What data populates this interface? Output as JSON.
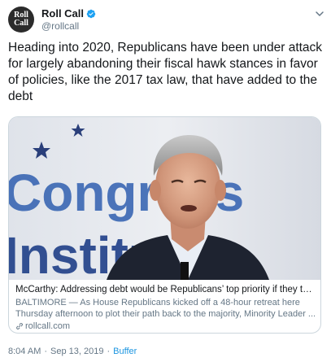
{
  "account": {
    "avatar_line1": "Roll",
    "avatar_line2": "Call",
    "display_name": "Roll Call",
    "handle": "@rollcall",
    "verified_icon": "verified-badge-icon"
  },
  "tweet": {
    "text": "Heading into 2020, Republicans have been under attack for largely abandoning their fiscal hawk stances in favor of policies, like the 2017 tax law, that have added to the debt"
  },
  "card": {
    "image_text_line1": "Congress",
    "image_text_line2": "Institute",
    "title": "McCarthy: Addressing debt would be Republicans’ top priority if they take ...",
    "description_line1": "BALTIMORE — As House Republicans kicked off a 48-hour retreat here",
    "description_line2": "Thursday afternoon to plot their path back to the majority, Minority Leader ...",
    "domain": "rollcall.com",
    "link_icon": "link-icon"
  },
  "meta": {
    "time": "8:04 AM",
    "date": "Sep 13, 2019",
    "separator": "·",
    "source": "Buffer"
  },
  "colors": {
    "text": "#14171a",
    "secondary": "#657786",
    "accent": "#1b95e0",
    "border": "#ccd6dd"
  }
}
